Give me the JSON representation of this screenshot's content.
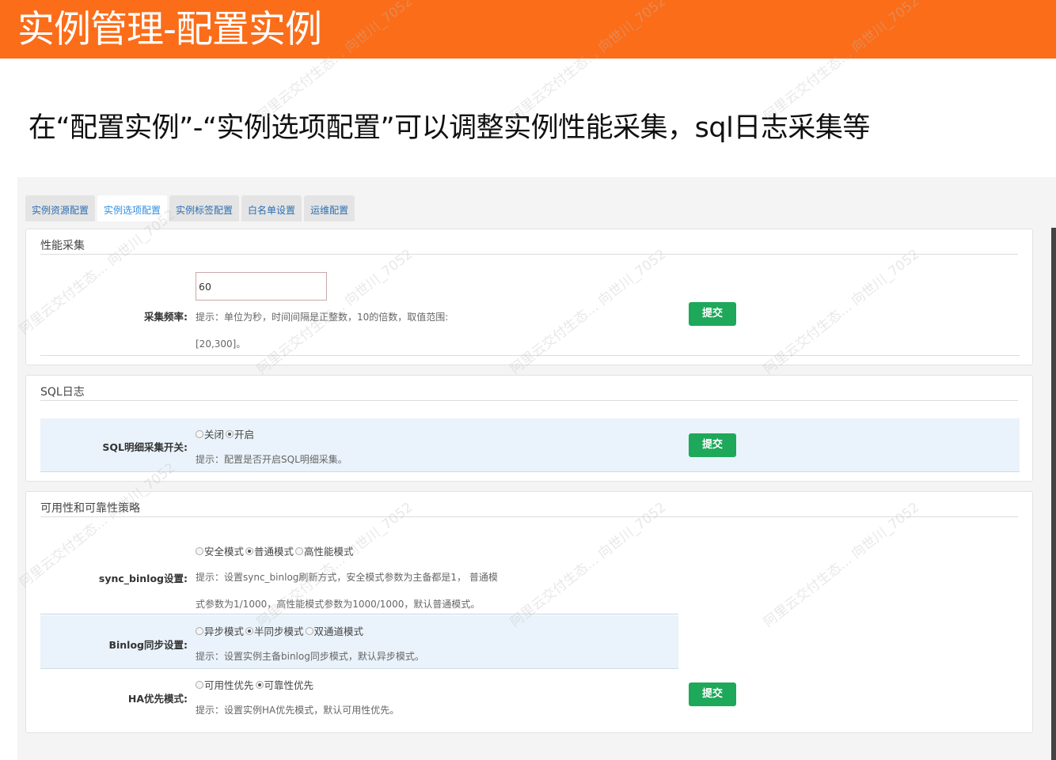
{
  "header": {
    "title": "实例管理-配置实例"
  },
  "subtitle": "在“配置实例”-“实例选项配置”可以调整实例性能采集，sql日志采集等",
  "tabs": [
    {
      "label": "实例资源配置",
      "active": false
    },
    {
      "label": "实例选项配置",
      "active": true
    },
    {
      "label": "实例标签配置",
      "active": false
    },
    {
      "label": "白名单设置",
      "active": false
    },
    {
      "label": "运维配置",
      "active": false
    }
  ],
  "perf_panel": {
    "title": "性能采集",
    "freq_label": "采集频率:",
    "freq_value": "60",
    "hint_line1": "提示：单位为秒，时间间隔是正整数，10的倍数，取值范围:",
    "hint_line2": "[20,300]。",
    "submit": "提交"
  },
  "sql_panel": {
    "title": "SQL日志",
    "switch_label": "SQL明细采集开关:",
    "options": [
      "关闭",
      "开启"
    ],
    "selected": "开启",
    "hint": "提示：配置是否开启SQL明细采集。",
    "submit": "提交"
  },
  "ha_panel": {
    "title": "可用性和可靠性策略",
    "sync_binlog": {
      "label": "sync_binlog设置:",
      "options": [
        "安全模式",
        "普通模式",
        "高性能模式"
      ],
      "selected": "普通模式",
      "hint_line1": "提示：设置sync_binlog刷新方式，安全模式参数为主备都是1， 普通模",
      "hint_line2": "式参数为1/1000，高性能模式参数为1000/1000，默认普通模式。"
    },
    "binlog_sync": {
      "label": "Binlog同步设置:",
      "options": [
        "异步模式",
        "半同步模式",
        "双通道模式"
      ],
      "selected": "半同步模式",
      "hint": "提示：设置实例主备binlog同步模式，默认异步模式。"
    },
    "ha_priority": {
      "label": "HA优先模式:",
      "options": [
        "可用性优先",
        "可靠性优先"
      ],
      "selected": "可靠性优先",
      "hint": "提示：设置实例HA优先模式，默认可用性优先。"
    },
    "submit": "提交"
  },
  "watermark_text": "阿里云交付生态... 向世川_7052",
  "colors": {
    "header": "#fb6d19",
    "button": "#1ea85a",
    "tab_active_text": "#2f8ee0",
    "highlight_row": "#eaf3fb"
  }
}
